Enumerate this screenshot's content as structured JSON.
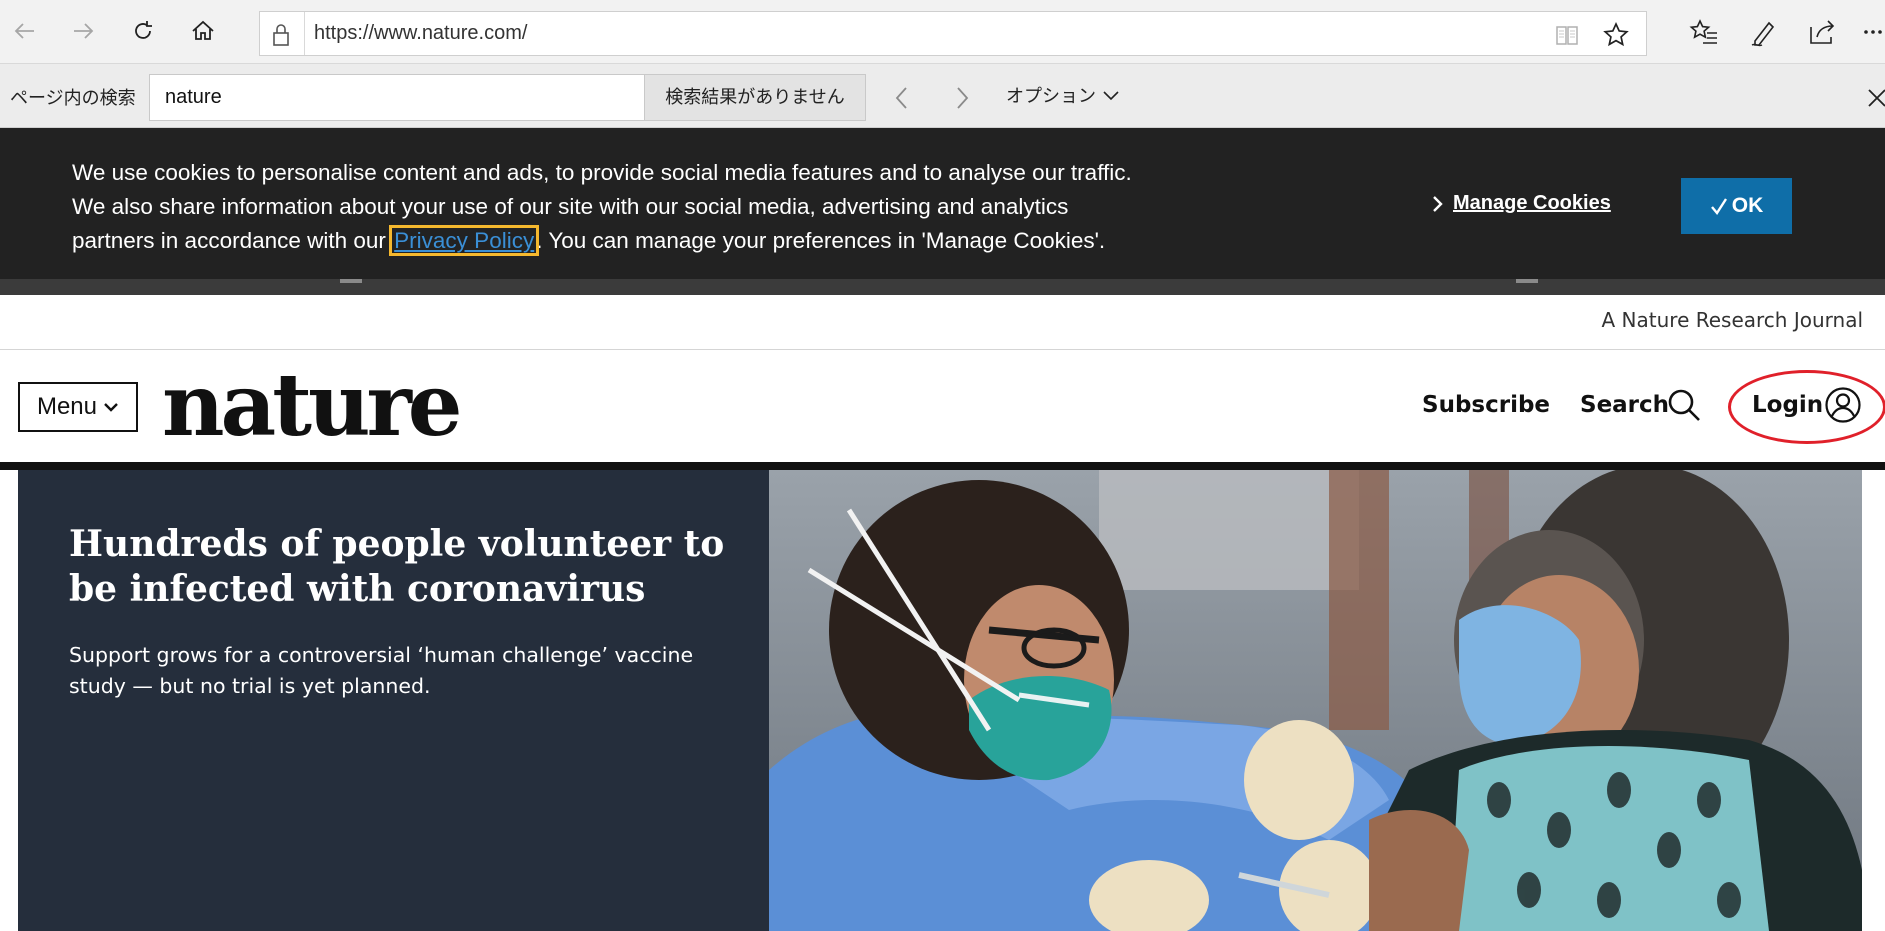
{
  "browser": {
    "url": "https://www.nature.com/"
  },
  "find_bar": {
    "label": "ページ内の検索",
    "query": "nature",
    "result": "検索結果がありません",
    "options_label": "オプション"
  },
  "cookie_banner": {
    "text_line1": "We use cookies to personalise content and ads, to provide social media features and to analyse our traffic.",
    "text_line2": "We also share information about your use of our site with our social media, advertising and analytics",
    "text_line3_before": "partners in accordance with our ",
    "privacy_link": "Privacy Policy",
    "text_line3_after": ". You can manage your preferences in 'Manage Cookies'.",
    "manage_cookies": "Manage Cookies",
    "ok_label": "OK",
    "ok_color": "#0f6ea8"
  },
  "site": {
    "journal_label": "A Nature Research Journal",
    "menu_label": "Menu",
    "logo": "nature",
    "subscribe": "Subscribe",
    "search": "Search",
    "login": "Login"
  },
  "hero": {
    "title": "Hundreds of people volunteer to be infected with coronavirus",
    "subtitle": "Support grows for a controversial ‘human challenge’ vaccine study — but no trial is yet planned."
  },
  "colors": {
    "banner_bg": "#222222",
    "hero_panel_bg": "#252e3c",
    "login_highlight": "#e0202a",
    "privacy_focus": "#f5b82e"
  }
}
